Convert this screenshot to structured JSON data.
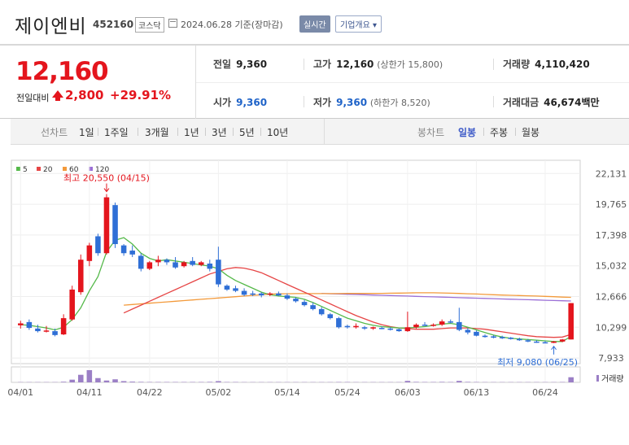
{
  "header": {
    "name": "제이엔비",
    "code": "452160",
    "market": "코스닥",
    "date": "2024.06.28 기준(장마감)",
    "realtime_label": "실시간",
    "overview_label": "기업개요 ▾"
  },
  "price": {
    "current": "12,160",
    "prev_label": "전일대비",
    "change": "2,800",
    "change_pct": "+29.91%"
  },
  "summary": {
    "prev_close_label": "전일",
    "prev_close": "9,360",
    "high_label": "고가",
    "high": "12,160",
    "upper_limit": "(상한가 15,800)",
    "volume_label": "거래량",
    "volume": "4,110,420",
    "open_label": "시가",
    "open": "9,360",
    "low_label": "저가",
    "low": "9,360",
    "lower_limit": "(하한가 8,520)",
    "amount_label": "거래대금",
    "amount": "46,674",
    "amount_unit": "백만"
  },
  "tabs": {
    "line_chart": "선차트",
    "periods": [
      "1일",
      "1주일",
      "3개월",
      "1년",
      "3년",
      "5년",
      "10년"
    ],
    "candle_chart": "봉차트",
    "candle_periods": [
      "일봉",
      "주봉",
      "월봉"
    ]
  },
  "colors": {
    "up": "#e4151d",
    "down": "#2f6fd6",
    "ma5": "#55b94a",
    "ma20": "#e64545",
    "ma60": "#f39a3b",
    "ma120": "#9b6fd6",
    "volume": "#9b7fc6"
  },
  "chart_data": {
    "type": "candlestick",
    "legend": [
      {
        "name": "5",
        "color": "#55b94a"
      },
      {
        "name": "20",
        "color": "#e64545"
      },
      {
        "name": "60",
        "color": "#f39a3b"
      },
      {
        "name": "120",
        "color": "#9b6fd6"
      }
    ],
    "ylim": [
      7500,
      22400
    ],
    "y_ticks": [
      "22,131",
      "19,765",
      "17,398",
      "15,032",
      "12,666",
      "10,299",
      "7,933"
    ],
    "y_tick_values": [
      22131,
      19765,
      17398,
      15032,
      12666,
      10299,
      7933
    ],
    "x_ticks": [
      "04/01",
      "04/11",
      "04/22",
      "05/02",
      "05/14",
      "05/24",
      "06/03",
      "06/13",
      "06/24"
    ],
    "x_tick_index": [
      0,
      8,
      15,
      23,
      31,
      38,
      45,
      53,
      61
    ],
    "high_annotation": "최고 20,550 (04/15)",
    "high_index": 10,
    "high_value": 20550,
    "low_annotation": "최저 9,080 (06/25)",
    "low_index": 62,
    "low_value": 9080,
    "volume_label": "거래량",
    "candles": [
      {
        "o": 10450,
        "h": 10800,
        "l": 10200,
        "c": 10600
      },
      {
        "o": 10700,
        "h": 10900,
        "l": 10100,
        "c": 10250
      },
      {
        "o": 10200,
        "h": 10500,
        "l": 9900,
        "c": 10000
      },
      {
        "o": 10000,
        "h": 10400,
        "l": 9900,
        "c": 10050
      },
      {
        "o": 10000,
        "h": 10200,
        "l": 9600,
        "c": 9700
      },
      {
        "o": 9750,
        "h": 11300,
        "l": 9700,
        "c": 11000
      },
      {
        "o": 10900,
        "h": 13500,
        "l": 10800,
        "c": 13200
      },
      {
        "o": 13000,
        "h": 15900,
        "l": 12800,
        "c": 15500
      },
      {
        "o": 15400,
        "h": 16800,
        "l": 15000,
        "c": 16600
      },
      {
        "o": 17300,
        "h": 17500,
        "l": 15800,
        "c": 16000
      },
      {
        "o": 16000,
        "h": 20550,
        "l": 15900,
        "c": 20300
      },
      {
        "o": 19700,
        "h": 19900,
        "l": 16400,
        "c": 16700
      },
      {
        "o": 16600,
        "h": 16700,
        "l": 15800,
        "c": 16000
      },
      {
        "o": 16200,
        "h": 16600,
        "l": 15700,
        "c": 15900
      },
      {
        "o": 15800,
        "h": 16000,
        "l": 14600,
        "c": 14800
      },
      {
        "o": 14800,
        "h": 15400,
        "l": 14700,
        "c": 15300
      },
      {
        "o": 15300,
        "h": 15800,
        "l": 15000,
        "c": 15500
      },
      {
        "o": 15500,
        "h": 15600,
        "l": 15100,
        "c": 15300
      },
      {
        "o": 15300,
        "h": 15700,
        "l": 14800,
        "c": 14900
      },
      {
        "o": 15000,
        "h": 15400,
        "l": 14900,
        "c": 15300
      },
      {
        "o": 15400,
        "h": 15700,
        "l": 15000,
        "c": 15100
      },
      {
        "o": 15100,
        "h": 15400,
        "l": 15000,
        "c": 15300
      },
      {
        "o": 15200,
        "h": 15500,
        "l": 14600,
        "c": 14800
      },
      {
        "o": 15500,
        "h": 16500,
        "l": 13400,
        "c": 13600
      },
      {
        "o": 13500,
        "h": 13600,
        "l": 13100,
        "c": 13200
      },
      {
        "o": 13300,
        "h": 13500,
        "l": 13000,
        "c": 13100
      },
      {
        "o": 13100,
        "h": 13300,
        "l": 12700,
        "c": 12800
      },
      {
        "o": 12900,
        "h": 13100,
        "l": 12700,
        "c": 12850
      },
      {
        "o": 12900,
        "h": 13000,
        "l": 12600,
        "c": 12750
      },
      {
        "o": 12850,
        "h": 13000,
        "l": 12700,
        "c": 12900
      },
      {
        "o": 12900,
        "h": 13050,
        "l": 12700,
        "c": 12750
      },
      {
        "o": 12750,
        "h": 12900,
        "l": 12400,
        "c": 12500
      },
      {
        "o": 12500,
        "h": 12600,
        "l": 12200,
        "c": 12300
      },
      {
        "o": 12250,
        "h": 12400,
        "l": 11900,
        "c": 12000
      },
      {
        "o": 12000,
        "h": 12200,
        "l": 11600,
        "c": 11700
      },
      {
        "o": 11700,
        "h": 11850,
        "l": 11200,
        "c": 11300
      },
      {
        "o": 11300,
        "h": 11400,
        "l": 10900,
        "c": 11000
      },
      {
        "o": 11000,
        "h": 11100,
        "l": 10200,
        "c": 10300
      },
      {
        "o": 10400,
        "h": 10500,
        "l": 10200,
        "c": 10300
      },
      {
        "o": 10300,
        "h": 10600,
        "l": 10200,
        "c": 10400
      },
      {
        "o": 10300,
        "h": 10400,
        "l": 10100,
        "c": 10200
      },
      {
        "o": 10200,
        "h": 10350,
        "l": 10100,
        "c": 10300
      },
      {
        "o": 10250,
        "h": 10350,
        "l": 10150,
        "c": 10200
      },
      {
        "o": 10200,
        "h": 10300,
        "l": 10050,
        "c": 10150
      },
      {
        "o": 10150,
        "h": 10200,
        "l": 9950,
        "c": 10000
      },
      {
        "o": 10000,
        "h": 11500,
        "l": 9950,
        "c": 10300
      },
      {
        "o": 10300,
        "h": 10600,
        "l": 10200,
        "c": 10500
      },
      {
        "o": 10500,
        "h": 10700,
        "l": 10400,
        "c": 10450
      },
      {
        "o": 10450,
        "h": 10600,
        "l": 10350,
        "c": 10500
      },
      {
        "o": 10500,
        "h": 10900,
        "l": 10400,
        "c": 10750
      },
      {
        "o": 10750,
        "h": 10900,
        "l": 10600,
        "c": 10700
      },
      {
        "o": 10700,
        "h": 11800,
        "l": 10000,
        "c": 10100
      },
      {
        "o": 10100,
        "h": 10250,
        "l": 9750,
        "c": 9900
      },
      {
        "o": 9950,
        "h": 10050,
        "l": 9600,
        "c": 9650
      },
      {
        "o": 9650,
        "h": 9750,
        "l": 9500,
        "c": 9550
      },
      {
        "o": 9600,
        "h": 9700,
        "l": 9450,
        "c": 9500
      },
      {
        "o": 9550,
        "h": 9650,
        "l": 9400,
        "c": 9450
      },
      {
        "o": 9500,
        "h": 9550,
        "l": 9350,
        "c": 9400
      },
      {
        "o": 9400,
        "h": 9500,
        "l": 9250,
        "c": 9300
      },
      {
        "o": 9300,
        "h": 9400,
        "l": 9150,
        "c": 9200
      },
      {
        "o": 9200,
        "h": 9300,
        "l": 9100,
        "c": 9150
      },
      {
        "o": 9150,
        "h": 9250,
        "l": 9080,
        "c": 9100
      },
      {
        "o": 9100,
        "h": 9250,
        "l": 9080,
        "c": 9200
      },
      {
        "o": 9200,
        "h": 9400,
        "l": 9150,
        "c": 9360
      },
      {
        "o": 9360,
        "h": 12160,
        "l": 9360,
        "c": 12160
      }
    ],
    "volumes": [
      0.02,
      0.02,
      0.02,
      0.02,
      0.02,
      0.05,
      0.22,
      0.62,
      1.0,
      0.35,
      0.15,
      0.25,
      0.1,
      0.06,
      0.04,
      0.03,
      0.03,
      0.03,
      0.03,
      0.03,
      0.03,
      0.03,
      0.04,
      0.1,
      0.03,
      0.03,
      0.02,
      0.02,
      0.02,
      0.02,
      0.02,
      0.02,
      0.02,
      0.02,
      0.02,
      0.02,
      0.02,
      0.03,
      0.03,
      0.02,
      0.02,
      0.02,
      0.02,
      0.02,
      0.02,
      0.12,
      0.04,
      0.03,
      0.03,
      0.04,
      0.03,
      0.12,
      0.04,
      0.03,
      0.02,
      0.02,
      0.02,
      0.02,
      0.02,
      0.02,
      0.02,
      0.02,
      0.02,
      0.03,
      0.42
    ],
    "ma5": [
      10500,
      10450,
      10350,
      10250,
      10100,
      10300,
      10900,
      11800,
      13100,
      14200,
      16100,
      17000,
      17200,
      16700,
      16000,
      15600,
      15400,
      15500,
      15400,
      15300,
      15200,
      15100,
      15000,
      14800,
      14300,
      13900,
      13600,
      13300,
      13000,
      12800,
      12700,
      12650,
      12600,
      12450,
      12200,
      11900,
      11600,
      11300,
      11000,
      10800,
      10600,
      10450,
      10350,
      10300,
      10250,
      10250,
      10300,
      10350,
      10450,
      10550,
      10600,
      10500,
      10300,
      10100,
      9900,
      9700,
      9550,
      9450,
      9400,
      9350,
      9300,
      9250,
      9200,
      9200,
      9600
    ],
    "ma20": [
      null,
      null,
      null,
      null,
      null,
      null,
      null,
      null,
      null,
      null,
      null,
      null,
      11400,
      11700,
      12000,
      12300,
      12600,
      12900,
      13200,
      13500,
      13800,
      14100,
      14400,
      14600,
      14800,
      14900,
      14850,
      14700,
      14500,
      14200,
      13900,
      13600,
      13300,
      13000,
      12700,
      12400,
      12100,
      11800,
      11500,
      11200,
      10950,
      10700,
      10500,
      10350,
      10250,
      10200,
      10150,
      10150,
      10150,
      10200,
      10250,
      10250,
      10250,
      10200,
      10150,
      10050,
      9950,
      9850,
      9750,
      9650,
      9580,
      9550,
      9520,
      9550,
      9750
    ],
    "ma60": [
      null,
      null,
      null,
      null,
      null,
      null,
      null,
      null,
      null,
      null,
      null,
      null,
      12000,
      12050,
      12100,
      12150,
      12200,
      12250,
      12300,
      12350,
      12400,
      12450,
      12500,
      12550,
      12600,
      12650,
      12700,
      12750,
      12800,
      12850,
      12870,
      12880,
      12890,
      12890,
      12890,
      12890,
      12890,
      12890,
      12900,
      12900,
      12900,
      12900,
      12910,
      12920,
      12930,
      12940,
      12950,
      12950,
      12950,
      12940,
      12920,
      12900,
      12880,
      12860,
      12830,
      12800,
      12780,
      12760,
      12740,
      12720,
      12700,
      12680,
      12650,
      12620,
      12600
    ],
    "ma120": [
      null,
      null,
      null,
      null,
      null,
      null,
      null,
      null,
      null,
      null,
      null,
      null,
      null,
      null,
      null,
      null,
      null,
      null,
      null,
      null,
      null,
      null,
      null,
      null,
      null,
      null,
      null,
      null,
      null,
      null,
      null,
      null,
      null,
      null,
      null,
      12900,
      12880,
      12860,
      12840,
      12820,
      12800,
      12780,
      12760,
      12740,
      12720,
      12700,
      12680,
      12660,
      12640,
      12620,
      12600,
      12580,
      12560,
      12540,
      12520,
      12500,
      12480,
      12460,
      12440,
      12420,
      12400,
      12380,
      12360,
      12340,
      12320
    ]
  }
}
